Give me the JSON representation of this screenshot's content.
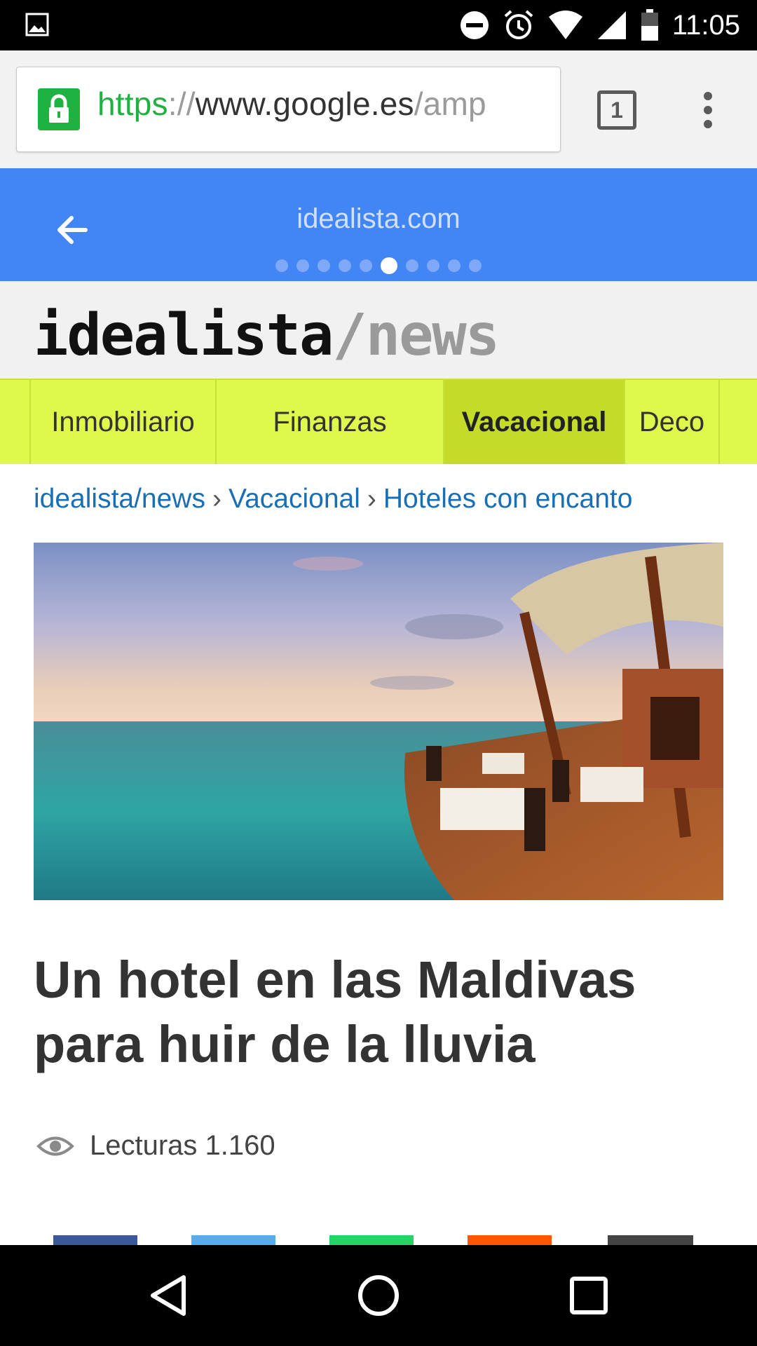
{
  "status_bar": {
    "time": "11:05",
    "icons": [
      "image-notification-icon",
      "do-not-disturb-icon",
      "alarm-icon",
      "wifi-icon",
      "signal-icon",
      "battery-icon"
    ]
  },
  "browser": {
    "url_scheme": "https",
    "url_sep": "://",
    "url_host": "www.google.es",
    "url_path": "/amp",
    "tab_count": "1",
    "secure_color": "#1fb141"
  },
  "amp_header": {
    "domain": "idealista.com",
    "page_indicator": {
      "total": 10,
      "active": 6
    },
    "color": "#4285f4"
  },
  "site": {
    "logo_main": "idealista",
    "logo_sub": "/news"
  },
  "nav": {
    "items": [
      {
        "label": "Inmobiliario"
      },
      {
        "label": "Finanzas"
      },
      {
        "label": "Vacacional"
      },
      {
        "label": "Deco"
      }
    ],
    "active_index": 2,
    "color": "#dff84b"
  },
  "breadcrumb": [
    "idealista/news",
    "Vacacional",
    "Hoteles con encanto"
  ],
  "article": {
    "headline": "Un hotel en las Maldivas para huir de la lluvia",
    "reads_label": "Lecturas",
    "reads_count": "1.160"
  },
  "share_colors": [
    "#3b5998",
    "#55acee",
    "#25d366",
    "#ff5700",
    "#444444"
  ]
}
